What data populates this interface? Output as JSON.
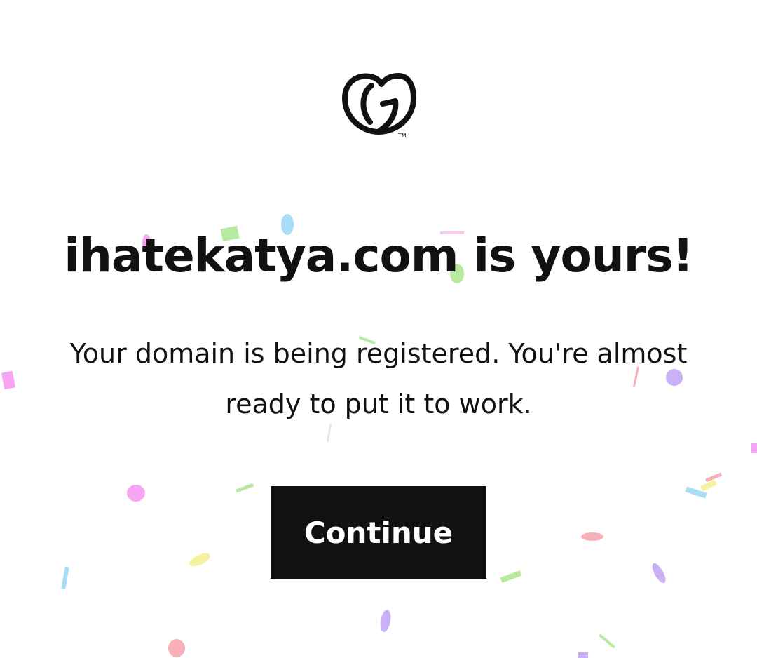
{
  "brand": {
    "logo_icon": "godaddy-logo-icon",
    "trademark": "TM"
  },
  "headline": "ihatekatya.com is yours!",
  "subtitle": "Your domain is being registered. You're almost ready to put it to work.",
  "continue_button": {
    "label": "Continue"
  },
  "colors": {
    "text": "#111111",
    "button_bg": "#111111",
    "button_text": "#ffffff",
    "background": "#ffffff",
    "confetti": [
      "#f6a6f3",
      "#b7e9a0",
      "#a8dcf7",
      "#c9b0f7",
      "#f7f2a0",
      "#f7b0b8"
    ]
  }
}
